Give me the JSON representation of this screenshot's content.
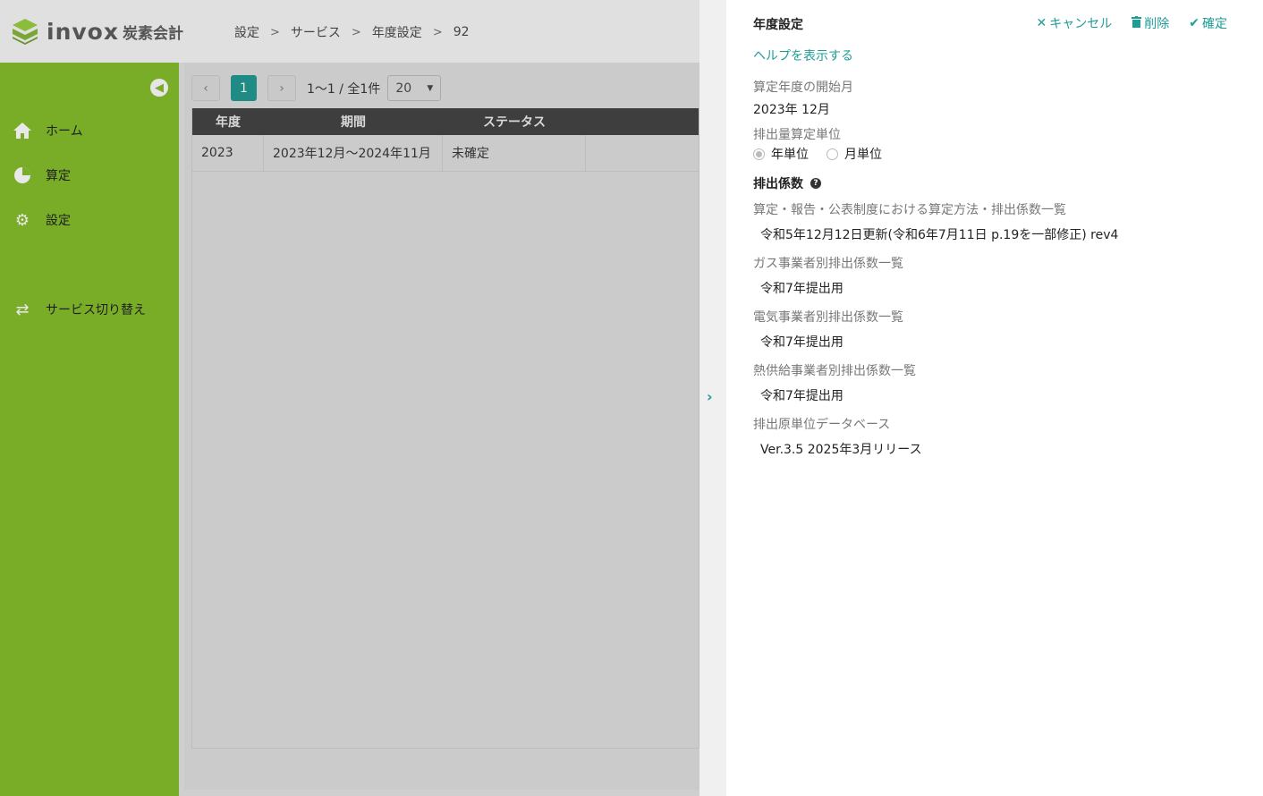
{
  "header": {
    "logo_text": "invox",
    "logo_sub": "炭素会計",
    "breadcrumb": [
      "設定",
      "サービス",
      "年度設定",
      "92"
    ]
  },
  "sidebar": {
    "items": [
      {
        "label": "ホーム",
        "icon": "home-icon"
      },
      {
        "label": "算定",
        "icon": "pie-chart-icon"
      },
      {
        "label": "設定",
        "icon": "gear-icon"
      },
      {
        "label": "サービス切り替え",
        "icon": "switch-icon"
      }
    ]
  },
  "pager": {
    "current_page": "1",
    "info": "1〜1 / 全1件",
    "page_size": "20"
  },
  "table": {
    "headers": [
      "年度",
      "期間",
      "ステータス"
    ],
    "rows": [
      [
        "2023",
        "2023年12月〜2024年11月",
        "未確定"
      ]
    ]
  },
  "panel": {
    "title": "年度設定",
    "actions": {
      "cancel": "キャンセル",
      "delete": "削除",
      "confirm": "確定"
    },
    "help_link": "ヘルプを表示する",
    "start_month_label": "算定年度の開始月",
    "start_month_value": "2023年 12月",
    "unit_label": "排出量算定単位",
    "unit_options": [
      "年単位",
      "月単位"
    ],
    "unit_selected": "年単位",
    "coeff_section": "排出係数",
    "coeff_fields": [
      {
        "label": "算定・報告・公表制度における算定方法・排出係数一覧",
        "value": "令和5年12月12日更新(令和6年7月11日 p.19を一部修正) rev4"
      },
      {
        "label": "ガス事業者別排出係数一覧",
        "value": "令和7年提出用"
      },
      {
        "label": "電気事業者別排出係数一覧",
        "value": "令和7年提出用"
      },
      {
        "label": "熱供給事業者別排出係数一覧",
        "value": "令和7年提出用"
      },
      {
        "label": "排出原単位データベース",
        "value": "Ver.3.5 2025年3月リリース"
      }
    ]
  },
  "colors": {
    "accent": "#1f9c96",
    "sidebar": "#79ad27",
    "pager_active": "#208a84"
  }
}
